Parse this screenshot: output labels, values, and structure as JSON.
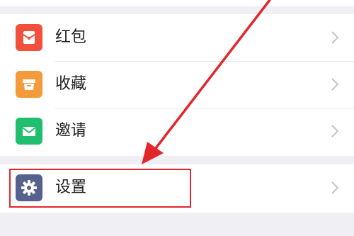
{
  "menu": {
    "items": [
      {
        "label": "红包",
        "icon": "red-envelope-icon",
        "color": "#f0503c"
      },
      {
        "label": "收藏",
        "icon": "favorites-box-icon",
        "color": "#f39a3a"
      },
      {
        "label": "邀请",
        "icon": "envelope-icon",
        "color": "#1fbf6f"
      }
    ],
    "settings": {
      "label": "设置",
      "icon": "gear-icon",
      "color": "#56618f"
    }
  },
  "annotation": {
    "highlight_color": "#e3262b"
  }
}
